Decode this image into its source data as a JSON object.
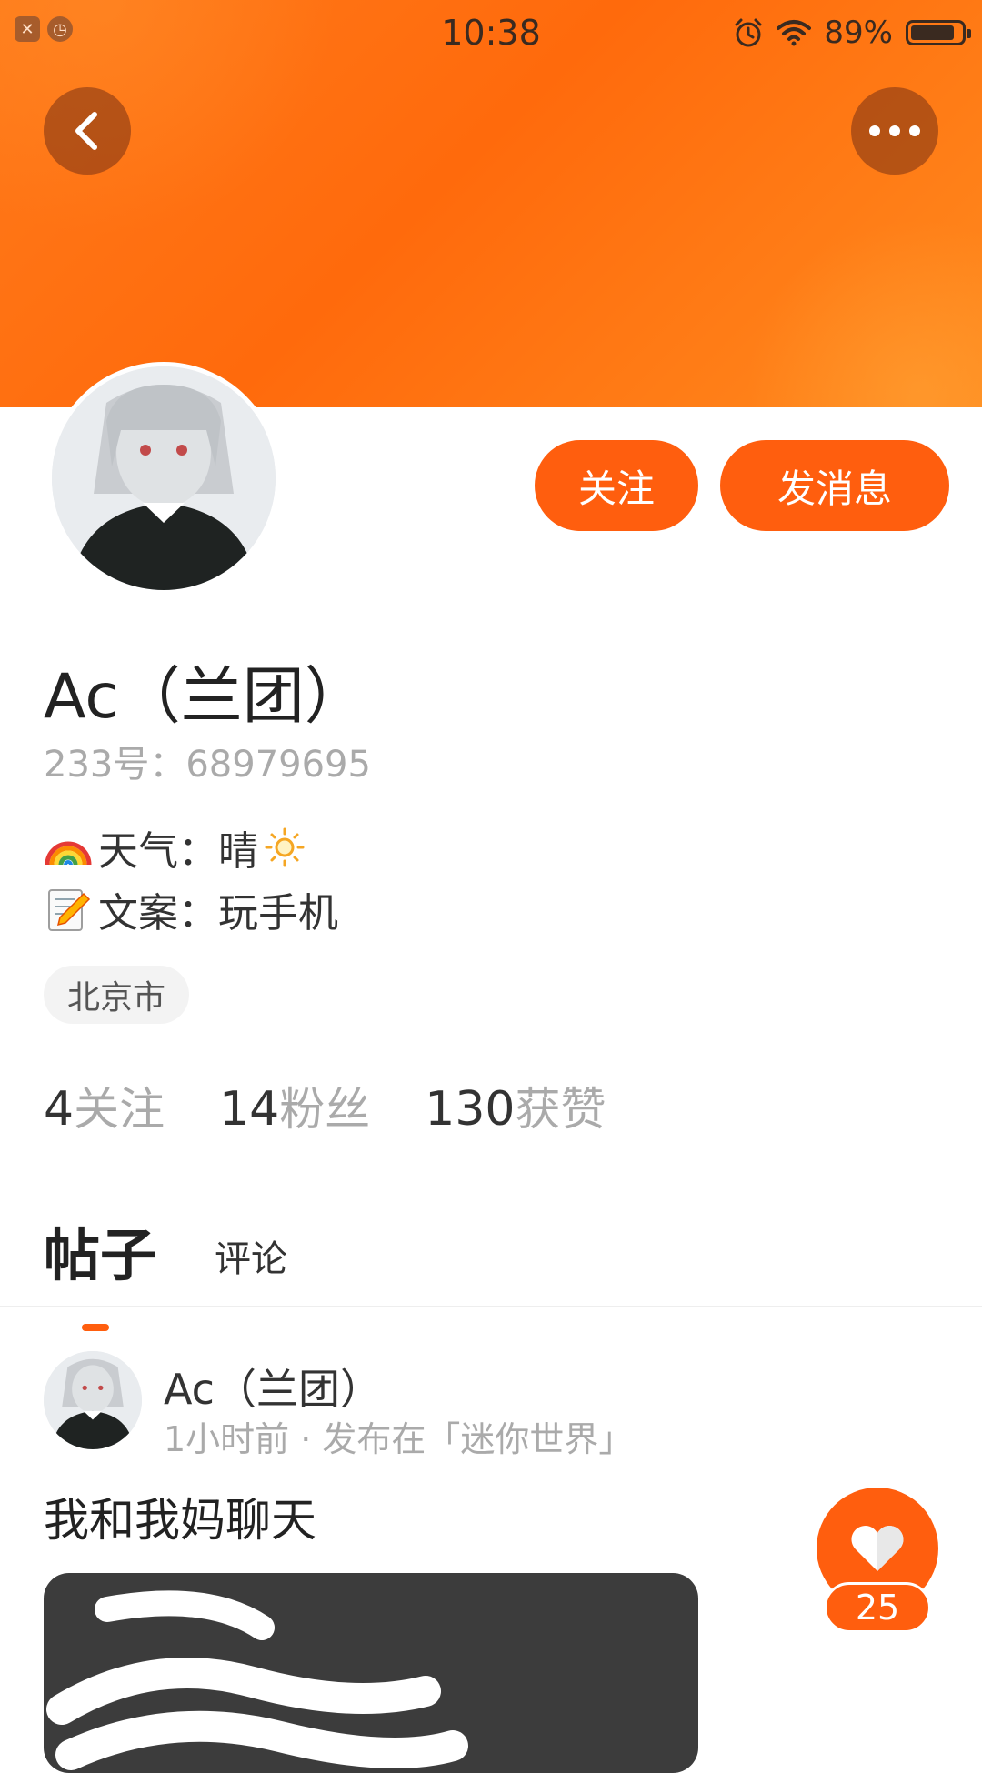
{
  "status_bar": {
    "time": "10:38",
    "battery_text": "89%",
    "battery_level": 0.89,
    "left_icons": [
      "notification-x-icon",
      "alarm-app-icon"
    ],
    "right_icons": [
      "alarm-icon",
      "wifi-icon",
      "battery-icon"
    ]
  },
  "header": {
    "back_icon": "back-arrow-icon",
    "more_icon": "more-dots-icon",
    "accent_color": "#ff6a0c"
  },
  "profile": {
    "name": "Ac（兰团）",
    "id_line": "233号：68979695",
    "bio_lines": [
      {
        "emoji": "rainbow-emoji",
        "text": "天气：晴",
        "suffix_icon": "sun-icon"
      },
      {
        "emoji": "memo-emoji",
        "text": "文案：玩手机"
      }
    ],
    "location_tag": "北京市",
    "stats": [
      {
        "num": "4",
        "label": "关注"
      },
      {
        "num": "14",
        "label": "粉丝"
      },
      {
        "num": "130",
        "label": "获赞"
      }
    ]
  },
  "actions": {
    "follow": "关注",
    "message": "发消息"
  },
  "tabs": {
    "posts": "帖子",
    "comments": "评论",
    "active": "posts"
  },
  "post": {
    "author": "Ac（兰团）",
    "meta": "1小时前 · 发布在「迷你世界」",
    "title": "我和我妈聊天",
    "likes": "25",
    "like_icon": "heart-icon"
  }
}
